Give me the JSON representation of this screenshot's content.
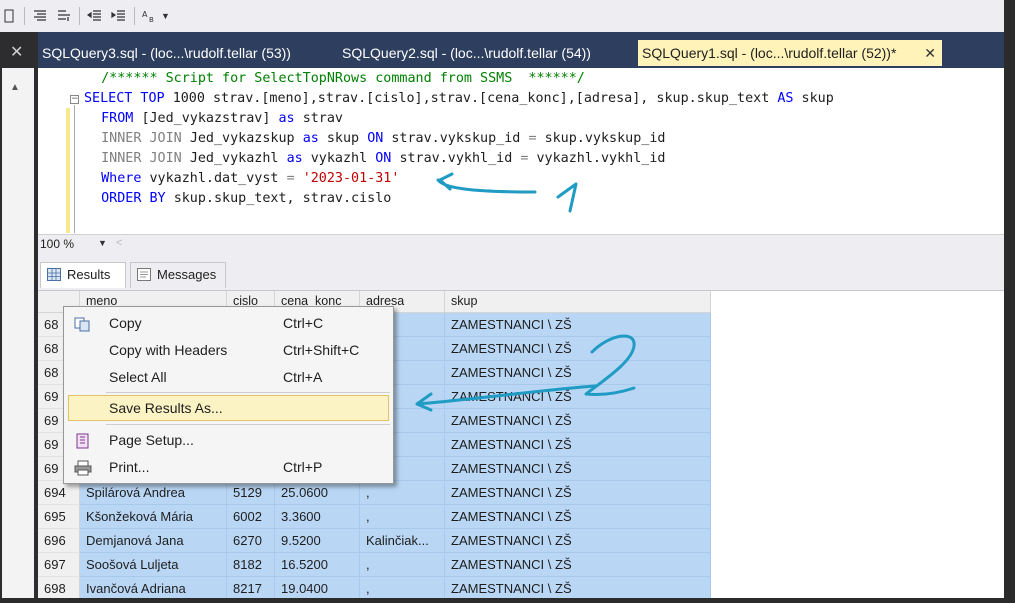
{
  "window": {
    "tabs": [
      {
        "label": "SQLQuery3.sql - (loc...\\rudolf.tellar (53))",
        "active": false
      },
      {
        "label": "SQLQuery2.sql - (loc...\\rudolf.tellar (54))",
        "active": false
      },
      {
        "label": "SQLQuery1.sql - (loc...\\rudolf.tellar (52))*",
        "active": true
      }
    ],
    "close_glyph": "✕",
    "tab_close_glyph": "✕"
  },
  "editor": {
    "lines": [
      {
        "indent": "  ",
        "parts": [
          {
            "t": "cmt",
            "v": "/****** Script for SelectTopNRows command from SSMS  ******/"
          }
        ]
      },
      {
        "indent": "",
        "parts": [
          {
            "t": "kw",
            "v": "SELECT TOP "
          },
          {
            "t": "plain",
            "v": "1000 strav.[meno],strav.[cislo],strav.[cena_konc],[adresa], skup.skup_text "
          },
          {
            "t": "kw",
            "v": "AS "
          },
          {
            "t": "plain",
            "v": "skup"
          }
        ]
      },
      {
        "indent": "  ",
        "parts": [
          {
            "t": "kw",
            "v": "FROM "
          },
          {
            "t": "plain",
            "v": "[Jed_vykazstrav] "
          },
          {
            "t": "kw",
            "v": "as "
          },
          {
            "t": "plain",
            "v": "strav"
          }
        ]
      },
      {
        "indent": "  ",
        "parts": [
          {
            "t": "gray",
            "v": "INNER JOIN "
          },
          {
            "t": "plain",
            "v": "Jed_vykazskup "
          },
          {
            "t": "kw",
            "v": "as "
          },
          {
            "t": "plain",
            "v": "skup "
          },
          {
            "t": "kw",
            "v": "ON "
          },
          {
            "t": "plain",
            "v": "strav.vykskup_id "
          },
          {
            "t": "gray",
            "v": "= "
          },
          {
            "t": "plain",
            "v": "skup.vykskup_id"
          }
        ]
      },
      {
        "indent": "  ",
        "parts": [
          {
            "t": "gray",
            "v": "INNER JOIN "
          },
          {
            "t": "plain",
            "v": "Jed_vykazhl "
          },
          {
            "t": "kw",
            "v": "as "
          },
          {
            "t": "plain",
            "v": "vykazhl "
          },
          {
            "t": "kw",
            "v": "ON "
          },
          {
            "t": "plain",
            "v": "strav.vykhl_id "
          },
          {
            "t": "gray",
            "v": "= "
          },
          {
            "t": "plain",
            "v": "vykazhl.vykhl_id"
          }
        ]
      },
      {
        "indent": "  ",
        "parts": [
          {
            "t": "kw",
            "v": "Where "
          },
          {
            "t": "plain",
            "v": "vykazhl.dat_vyst "
          },
          {
            "t": "gray",
            "v": "= "
          },
          {
            "t": "str",
            "v": "'2023-01-31'"
          }
        ]
      },
      {
        "indent": "  ",
        "parts": [
          {
            "t": "kw",
            "v": "ORDER BY "
          },
          {
            "t": "plain",
            "v": "skup.skup_text, strav.cislo"
          }
        ]
      }
    ]
  },
  "zoom": {
    "value": "100 %"
  },
  "results_tabs": [
    {
      "label": "Results",
      "active": true
    },
    {
      "label": "Messages",
      "active": false
    }
  ],
  "grid": {
    "columns": [
      "meno",
      "cislo",
      "cena_konc",
      "adresa",
      "skup"
    ],
    "rows": [
      {
        "rn": "68",
        "meno": "",
        "cislo": "",
        "cena": "",
        "adresa": "",
        "skup": "ZAMESTNANCI \\ ZŠ"
      },
      {
        "rn": "68",
        "meno": "",
        "cislo": "",
        "cena": "",
        "adresa": "",
        "skup": "ZAMESTNANCI \\ ZŠ"
      },
      {
        "rn": "68",
        "meno": "",
        "cislo": "",
        "cena": "",
        "adresa": "",
        "skup": "ZAMESTNANCI \\ ZŠ"
      },
      {
        "rn": "69",
        "meno": "",
        "cislo": "",
        "cena": "",
        "adresa": "",
        "skup": "ZAMESTNANCI \\ ZŠ"
      },
      {
        "rn": "69",
        "meno": "",
        "cislo": "",
        "cena": "",
        "adresa": "",
        "skup": "ZAMESTNANCI \\ ZŠ"
      },
      {
        "rn": "69",
        "meno": "",
        "cislo": "",
        "cena": "",
        "adresa": "",
        "skup": "ZAMESTNANCI \\ ZŠ"
      },
      {
        "rn": "69",
        "meno": "",
        "cislo": "",
        "cena": "",
        "adresa": "",
        "skup": "ZAMESTNANCI \\ ZŠ"
      },
      {
        "rn": "694",
        "meno": "Spilárová Andrea",
        "cislo": "5129",
        "cena": "25.0600",
        "adresa": ",",
        "skup": "ZAMESTNANCI \\ ZŠ"
      },
      {
        "rn": "695",
        "meno": "Kšonžeková Mária",
        "cislo": "6002",
        "cena": "3.3600",
        "adresa": ",",
        "skup": "ZAMESTNANCI \\ ZŠ"
      },
      {
        "rn": "696",
        "meno": "Demjanová Jana",
        "cislo": "6270",
        "cena": "9.5200",
        "adresa": "Kalinčiak...",
        "skup": "ZAMESTNANCI \\ ZŠ"
      },
      {
        "rn": "697",
        "meno": "Soošová Luljeta",
        "cislo": "8182",
        "cena": "16.5200",
        "adresa": ",",
        "skup": "ZAMESTNANCI \\ ZŠ"
      },
      {
        "rn": "698",
        "meno": "Ivančová Adriana",
        "cislo": "8217",
        "cena": "19.0400",
        "adresa": ",",
        "skup": "ZAMESTNANCI \\ ZŠ"
      }
    ]
  },
  "context_menu": {
    "items": [
      {
        "label": "Copy",
        "shortcut": "Ctrl+C",
        "icon": "copy-icon"
      },
      {
        "label": "Copy with Headers",
        "shortcut": "Ctrl+Shift+C",
        "icon": ""
      },
      {
        "label": "Select All",
        "shortcut": "Ctrl+A",
        "icon": ""
      },
      {
        "label": "Save Results As...",
        "shortcut": "",
        "icon": "",
        "highlighted": true
      },
      {
        "label": "Page Setup...",
        "shortcut": "",
        "icon": "page-setup-icon"
      },
      {
        "label": "Print...",
        "shortcut": "Ctrl+P",
        "icon": "printer-icon"
      }
    ]
  },
  "annotations": {
    "color": "#1f9bc4",
    "marks": [
      "arrow-1",
      "arrow-2"
    ]
  },
  "colors": {
    "tab_bar": "#2d3e5e",
    "active_tab": "#fff3b9",
    "selection": "#b9d7f5",
    "menu_highlight": "#fcf3c4"
  }
}
